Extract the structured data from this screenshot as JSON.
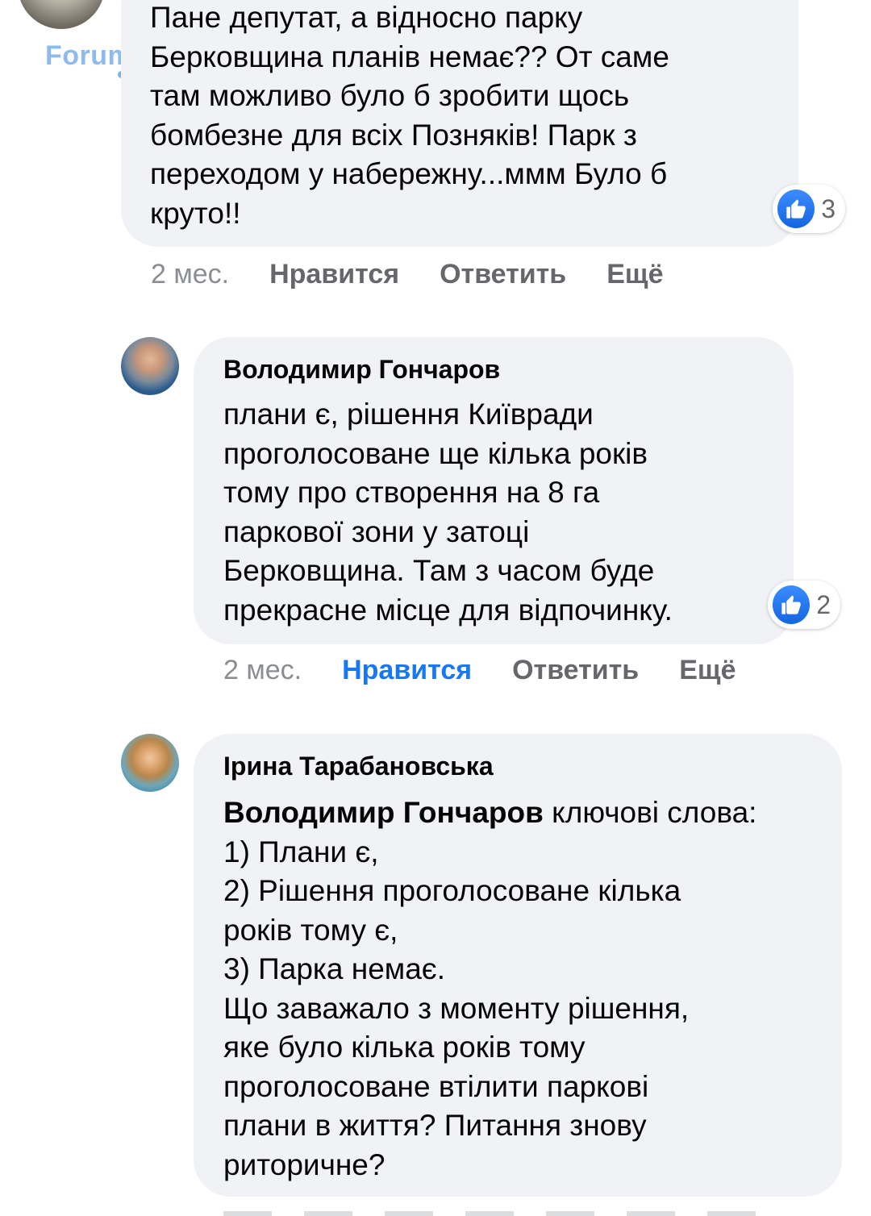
{
  "comments": [
    {
      "text": "Пане депутат, а відносно парку\nБерковщина планів немає?? От саме\nтам можливо було б зробити щось\nбомбезне для всіх Позняків! Парк з\nпереходом у набережну...ммм Було б\nкруто!!",
      "reactions": "3",
      "time": "2 мес.",
      "like_label": "Нравится",
      "reply_label": "Ответить",
      "more_label": "Ещё"
    },
    {
      "author": "Володимир Гончаров",
      "text": "плани є, рішення Київради\nпроголосоване ще кілька років\nтому про створення на 8 га\nпаркової зони у затоці\nБерковщина. Там з часом буде\nпрекрасне місце для відпочинку.",
      "reactions": "2",
      "time": "2 мес.",
      "like_label": "Нравится",
      "reply_label": "Ответить",
      "more_label": "Ещё"
    },
    {
      "author": "Ірина Тарабановська",
      "mention": "Володимир Гончаров",
      "text_after_mention": " ключові слова:",
      "text": "1) Плани є,\n2) Рішення проголосоване кілька\nроків тому є,\n3) Парка немає.\nЩо заважало з моменту рішення,\nяке було кілька років тому\nпроголосоване втілити паркові\nплани в життя? Питання знову\nриторичне?"
    }
  ],
  "watermark": "Forum.Dnepr.ua",
  "colors": {
    "bubble": "#f0f2f5",
    "link_blue": "#1877f2",
    "meta_gray": "#65676b"
  }
}
